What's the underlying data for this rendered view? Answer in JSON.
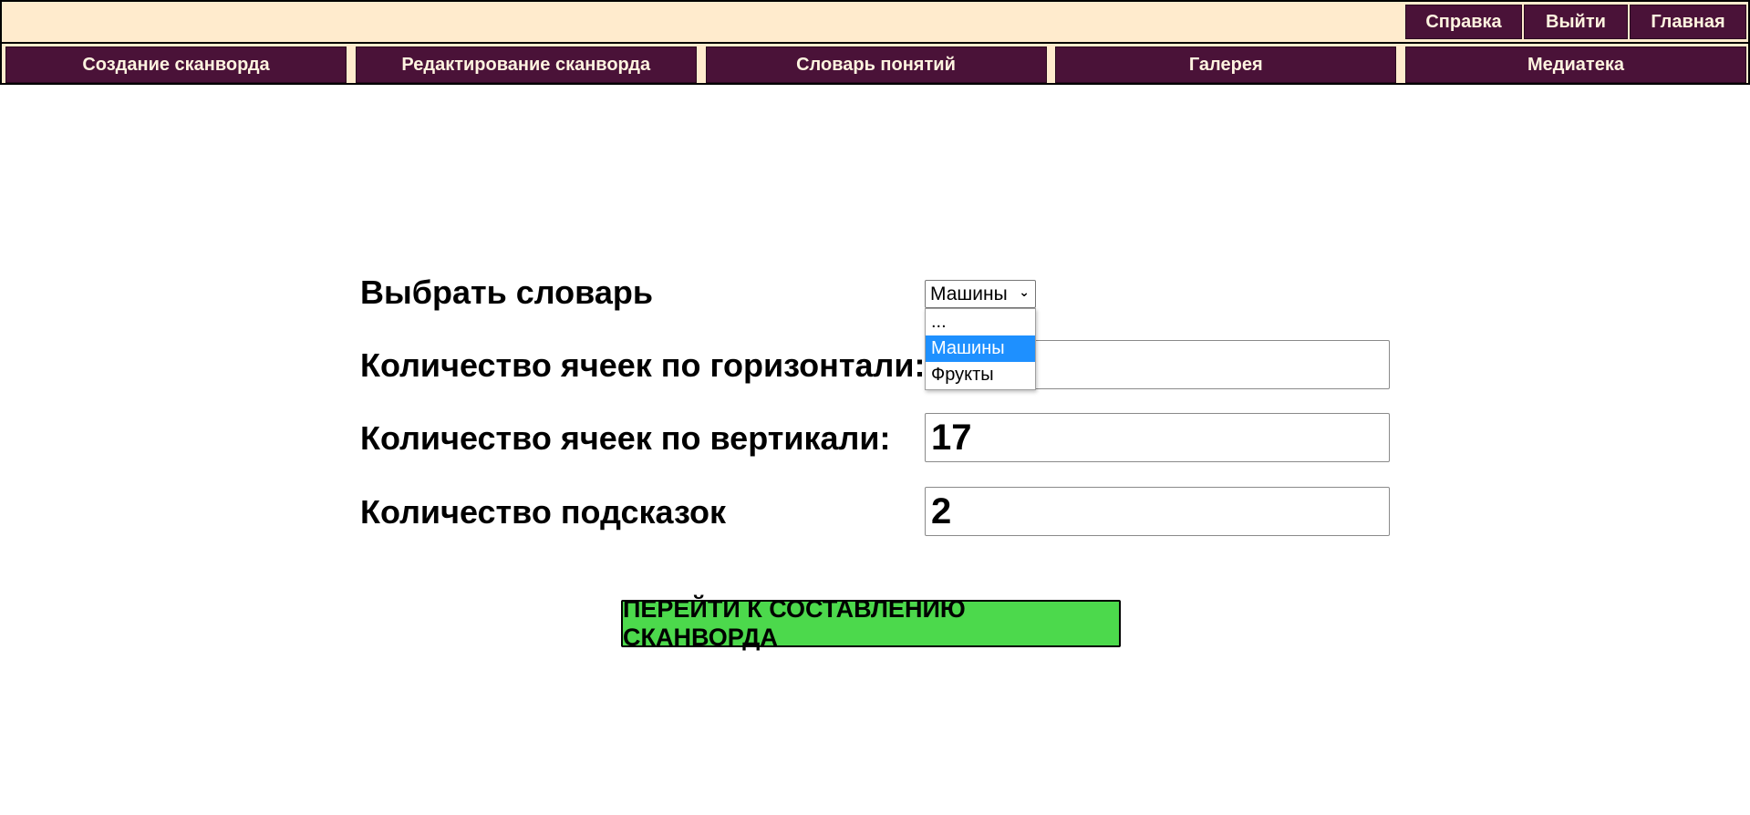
{
  "top_nav": {
    "help": "Справка",
    "logout": "Выйти",
    "home": "Главная"
  },
  "main_nav": [
    {
      "label": "Создание сканворда"
    },
    {
      "label": "Редактирование сканворда"
    },
    {
      "label": "Словарь понятий"
    },
    {
      "label": "Галерея"
    },
    {
      "label": "Медиатека"
    }
  ],
  "form": {
    "dictionary_label": "Выбрать словарь",
    "dictionary_selected": "Машины",
    "dictionary_options": [
      "...",
      "Машины",
      "Фрукты"
    ],
    "horizontal_label": "Количество ячеек по горизонтали:",
    "horizontal_value": "",
    "vertical_label": "Количество ячеек по вертикали:",
    "vertical_value": "17",
    "hints_label": "Количество подсказок",
    "hints_value": "2",
    "submit_label": "ПЕРЕЙТИ К СОСТАВЛЕНИЮ СКАНВОРДА"
  },
  "colors": {
    "header_bg": "#ffebcd",
    "nav_bg": "#4a1238",
    "nav_text": "#fff4e0",
    "submit_bg": "#4cd94c",
    "option_highlight": "#1e90ff"
  }
}
